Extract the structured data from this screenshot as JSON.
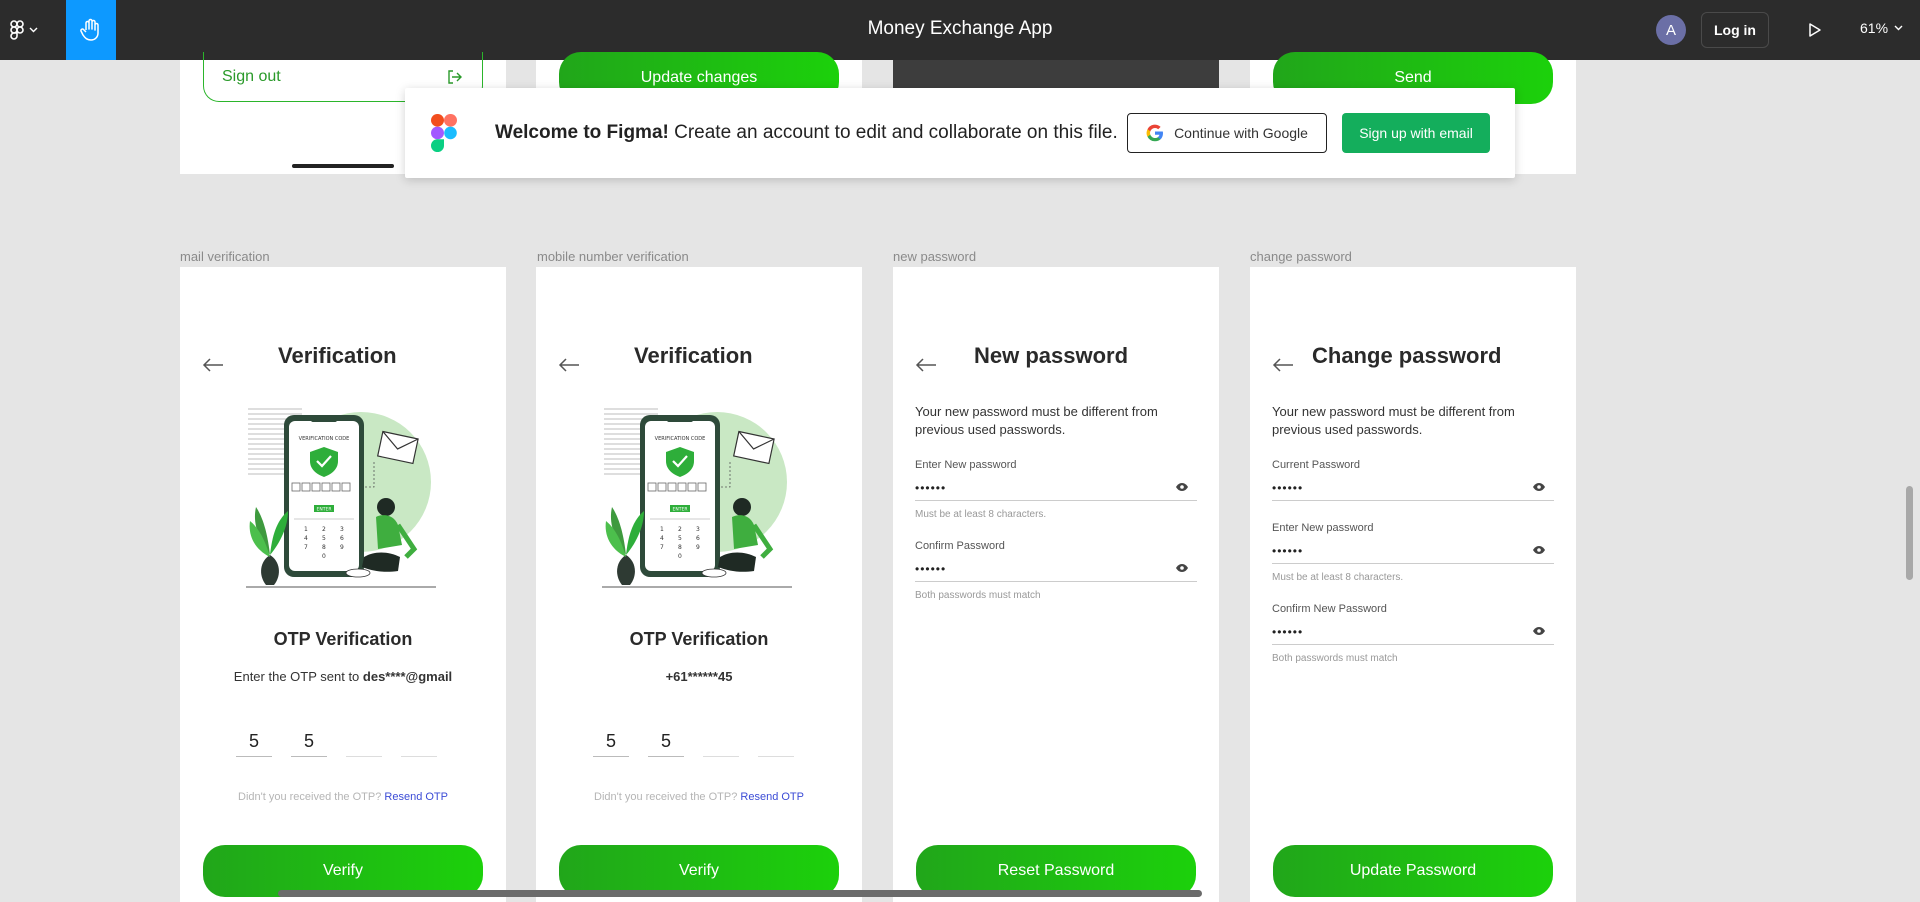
{
  "topbar": {
    "title": "Money Exchange App",
    "avatar_initial": "A",
    "login_label": "Log in",
    "zoom": "61%"
  },
  "top_row": {
    "signout_label": "Sign out",
    "update_label": "Update changes",
    "send_label": "Send"
  },
  "banner": {
    "welcome_bold": "Welcome to Figma!",
    "welcome_rest": " Create an account to edit and collaborate on this file.",
    "google_label": "Continue with Google",
    "email_label": "Sign up with email"
  },
  "frames": [
    {
      "label": "mail verification",
      "title": "Verification",
      "otp_title": "OTP Verification",
      "sub_prefix": "Enter the OTP sent to ",
      "sub_bold": "des****@gmail",
      "otp_digits": [
        "5",
        "5",
        "",
        ""
      ],
      "resend_text": "Didn't you received the OTP? ",
      "resend_link": "Resend OTP",
      "button": "Verify"
    },
    {
      "label": "mobile number verification",
      "title": "Verification",
      "otp_title": "OTP Verification",
      "sub_prefix": "",
      "sub_bold": "+61******45",
      "otp_digits": [
        "5",
        "5",
        "",
        ""
      ],
      "resend_text": "Didn't you received the OTP? ",
      "resend_link": "Resend OTP",
      "button": "Verify"
    },
    {
      "label": "new password",
      "title": "New password",
      "description": "Your new password must be different from previous used passwords.",
      "fields": [
        {
          "label": "Enter New password",
          "value": "••••••",
          "hint": "Must be at least 8 characters."
        },
        {
          "label": "Confirm Password",
          "value": "••••••",
          "hint": "Both passwords must match"
        }
      ],
      "button": "Reset Password"
    },
    {
      "label": "change password",
      "title": "Change password",
      "description": "Your new password must be different from previous used passwords.",
      "fields": [
        {
          "label": "Current Password",
          "value": "••••••",
          "hint": ""
        },
        {
          "label": "Enter New password",
          "value": "••••••",
          "hint": "Must be at least 8 characters."
        },
        {
          "label": "Confirm New Password",
          "value": "••••••",
          "hint": "Both passwords must match"
        }
      ],
      "button": "Update Password"
    }
  ],
  "illustration": {
    "screen_heading": "VERIFICATION CODE",
    "enter_label": "ENTER",
    "keypad": [
      "1",
      "2",
      "3",
      "4",
      "5",
      "6",
      "7",
      "8",
      "9",
      "0"
    ]
  },
  "colors": {
    "figma_toolbar": "#2c2c2c",
    "hand_tool_active": "#0d99ff",
    "brand_green": "#1cd10b",
    "signup_green": "#14ae5c",
    "link_blue": "#3b4bd6"
  }
}
